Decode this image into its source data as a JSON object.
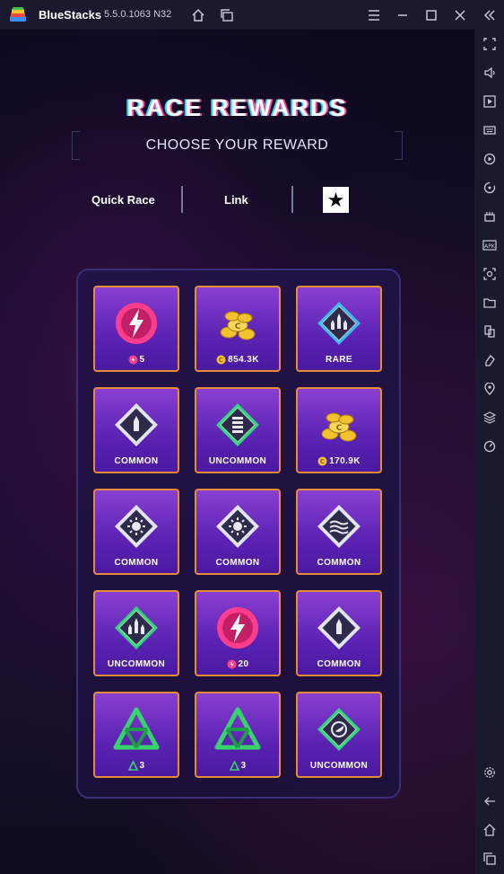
{
  "window": {
    "app_name": "BlueStacks",
    "version": "5.5.0.1063",
    "arch": "N32"
  },
  "game": {
    "title": "RACE REWARDS",
    "subtitle": "CHOOSE YOUR REWARD",
    "tabs": [
      "Quick Race",
      "Link"
    ],
    "star_tab_icon": "star-icon"
  },
  "rewards": [
    {
      "label": "5",
      "art": "energy-icon",
      "rarity": "energy",
      "label_icon": "energy"
    },
    {
      "label": "854.3K",
      "art": "coin-pile-icon",
      "rarity": "coins",
      "label_icon": "coin"
    },
    {
      "label": "RARE",
      "art": "rocket-diamond-icon",
      "rarity": "rare",
      "label_icon": ""
    },
    {
      "label": "COMMON",
      "art": "bullet-diamond-icon",
      "rarity": "common",
      "label_icon": ""
    },
    {
      "label": "UNCOMMON",
      "art": "stack-diamond-icon",
      "rarity": "uncommon",
      "label_icon": ""
    },
    {
      "label": "170.9K",
      "art": "coin-pile-icon",
      "rarity": "coins",
      "label_icon": "coin"
    },
    {
      "label": "COMMON",
      "art": "gear-diamond-icon",
      "rarity": "common",
      "label_icon": ""
    },
    {
      "label": "COMMON",
      "art": "gear-diamond-icon",
      "rarity": "common",
      "label_icon": ""
    },
    {
      "label": "COMMON",
      "art": "wave-diamond-icon",
      "rarity": "common",
      "label_icon": ""
    },
    {
      "label": "UNCOMMON",
      "art": "rocket-diamond-icon",
      "rarity": "uncommon",
      "label_icon": ""
    },
    {
      "label": "20",
      "art": "energy-icon",
      "rarity": "energy",
      "label_icon": "energy"
    },
    {
      "label": "COMMON",
      "art": "bullet-diamond-icon",
      "rarity": "common",
      "label_icon": ""
    },
    {
      "label": "3",
      "art": "green-pyramid-icon",
      "rarity": "pyramid",
      "label_icon": "pyramid"
    },
    {
      "label": "3",
      "art": "green-pyramid-icon",
      "rarity": "pyramid",
      "label_icon": "pyramid"
    },
    {
      "label": "UNCOMMON",
      "art": "moon-diamond-icon",
      "rarity": "uncommon",
      "label_icon": ""
    }
  ],
  "colors": {
    "common": "#e0e4f4",
    "uncommon": "#2fd67a",
    "rare": "#3fb8e8",
    "energy": "#ff3d8c",
    "coin": "#f2c12e",
    "card_border": "#e58b3a"
  }
}
